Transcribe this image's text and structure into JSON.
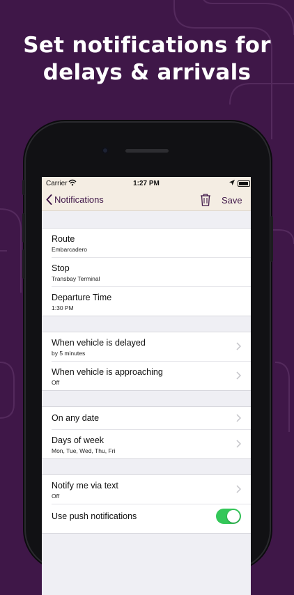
{
  "headline": {
    "line1": "Set notifications for",
    "line2": "delays & arrivals"
  },
  "status_bar": {
    "carrier": "Carrier",
    "time": "1:27 PM",
    "wifi_icon": "wifi-icon",
    "location_icon": "location-arrow-icon",
    "battery_icon": "battery-icon"
  },
  "nav": {
    "back_label": "Notifications",
    "back_icon": "chevron-left-icon",
    "delete_icon": "trash-icon",
    "save_label": "Save"
  },
  "trip": [
    {
      "title": "Route",
      "subtitle": "Embarcadero"
    },
    {
      "title": "Stop",
      "subtitle": "Transbay Terminal"
    },
    {
      "title": "Departure Time",
      "subtitle": "1:30 PM"
    }
  ],
  "alerts": [
    {
      "title": "When vehicle is delayed",
      "subtitle": "by 5 minutes"
    },
    {
      "title": "When vehicle is approaching",
      "subtitle": "Off"
    }
  ],
  "schedule": [
    {
      "title": "On any date"
    },
    {
      "title": "Days of week",
      "subtitle": "Mon, Tue, Wed, Thu, Fri"
    }
  ],
  "delivery": [
    {
      "title": "Notify me via text",
      "subtitle": "Off"
    },
    {
      "title": "Use push notifications",
      "toggle_on": true
    }
  ],
  "colors": {
    "background": "#3f1748",
    "accent": "#3f1748",
    "nav_bar": "#f4ede3",
    "toggle_on": "#34c759"
  }
}
